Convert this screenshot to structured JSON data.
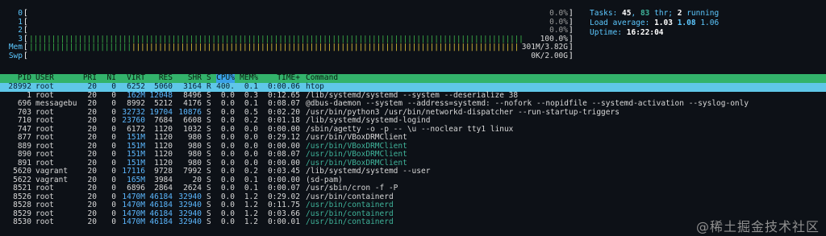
{
  "meters": [
    {
      "label": "0",
      "bar": "",
      "value": "0.0%"
    },
    {
      "label": "1",
      "bar": "",
      "value": "0.0%"
    },
    {
      "label": "2",
      "bar": "",
      "value": "0.0%"
    },
    {
      "label": "3",
      "bar": "|||||||||||||||||||||||||||||||||||||||||||||||||||||||||||||||||||||||||||||||||||||||||||||||||||||||||||||||||||||||||||||||||||||||||||||||||",
      "value": "100.0%"
    },
    {
      "label": "Mem",
      "bar_green": "|||||||||||||||||||||||",
      "bar_yellow": "|||||||||||||||||||||||||||||||||||||||||||||||||||||||||||||||||||||||||||||||||||||||||||||||||||||",
      "value": "301M/3.82G"
    },
    {
      "label": "Swp",
      "bar": "",
      "value": "0K/2.00G"
    }
  ],
  "summary": {
    "tasks_label": "Tasks: ",
    "tasks": "45",
    "tasks_sep": ", ",
    "threads": "83",
    "threads_label": " thr; ",
    "running": "2",
    "running_label": " running",
    "load_label": "Load average: ",
    "load1": "1.03",
    "load5": "1.08",
    "load15": "1.06",
    "uptime_label": "Uptime: ",
    "uptime": "16:22:04"
  },
  "columns": {
    "pid": "PID",
    "user": "USER",
    "pri": "PRI",
    "ni": "NI",
    "virt": "VIRT",
    "res": "RES",
    "shr": "SHR",
    "s": "S",
    "cpu": "CPU%",
    "mem": "MEM%",
    "time": "TIME+",
    "cmd": "Command"
  },
  "processes": [
    {
      "pid": "28992",
      "user": "root",
      "pri": "20",
      "ni": "0",
      "virt": "6252",
      "res": "5060",
      "shr": "3164",
      "s": "R",
      "cpu": "400.",
      "mem": "0.1",
      "time": "0:00.06",
      "cmd": "htop",
      "thread": false
    },
    {
      "pid": "1",
      "user": "root",
      "pri": "20",
      "ni": "0",
      "virt": "162M",
      "res": "12048",
      "shr": "8496",
      "s": "S",
      "cpu": "0.0",
      "mem": "0.3",
      "time": "0:12.65",
      "cmd": "/lib/systemd/systemd --system --deserialize 38",
      "thread": false
    },
    {
      "pid": "696",
      "user": "messagebu",
      "pri": "20",
      "ni": "0",
      "virt": "8992",
      "res": "5212",
      "shr": "4176",
      "s": "S",
      "cpu": "0.0",
      "mem": "0.1",
      "time": "0:08.07",
      "cmd": "@dbus-daemon --system --address=systemd: --nofork --nopidfile --systemd-activation --syslog-only",
      "thread": false
    },
    {
      "pid": "703",
      "user": "root",
      "pri": "20",
      "ni": "0",
      "virt": "32732",
      "res": "19704",
      "shr": "10876",
      "s": "S",
      "cpu": "0.0",
      "mem": "0.5",
      "time": "0:02.20",
      "cmd": "/usr/bin/python3 /usr/bin/networkd-dispatcher --run-startup-triggers",
      "thread": false
    },
    {
      "pid": "710",
      "user": "root",
      "pri": "20",
      "ni": "0",
      "virt": "23760",
      "res": "7684",
      "shr": "6608",
      "s": "S",
      "cpu": "0.0",
      "mem": "0.2",
      "time": "0:01.18",
      "cmd": "/lib/systemd/systemd-logind",
      "thread": false
    },
    {
      "pid": "747",
      "user": "root",
      "pri": "20",
      "ni": "0",
      "virt": "6172",
      "res": "1120",
      "shr": "1032",
      "s": "S",
      "cpu": "0.0",
      "mem": "0.0",
      "time": "0:00.00",
      "cmd": "/sbin/agetty -o -p -- \\u --noclear tty1 linux",
      "thread": false
    },
    {
      "pid": "877",
      "user": "root",
      "pri": "20",
      "ni": "0",
      "virt": "151M",
      "res": "1120",
      "shr": "980",
      "s": "S",
      "cpu": "0.0",
      "mem": "0.0",
      "time": "0:29.12",
      "cmd": "/usr/bin/VBoxDRMClient",
      "thread": false
    },
    {
      "pid": "889",
      "user": "root",
      "pri": "20",
      "ni": "0",
      "virt": "151M",
      "res": "1120",
      "shr": "980",
      "s": "S",
      "cpu": "0.0",
      "mem": "0.0",
      "time": "0:00.00",
      "cmd": "/usr/bin/VBoxDRMClient",
      "thread": true
    },
    {
      "pid": "890",
      "user": "root",
      "pri": "20",
      "ni": "0",
      "virt": "151M",
      "res": "1120",
      "shr": "980",
      "s": "S",
      "cpu": "0.0",
      "mem": "0.0",
      "time": "0:08.07",
      "cmd": "/usr/bin/VBoxDRMClient",
      "thread": true
    },
    {
      "pid": "891",
      "user": "root",
      "pri": "20",
      "ni": "0",
      "virt": "151M",
      "res": "1120",
      "shr": "980",
      "s": "S",
      "cpu": "0.0",
      "mem": "0.0",
      "time": "0:00.00",
      "cmd": "/usr/bin/VBoxDRMClient",
      "thread": true
    },
    {
      "pid": "5620",
      "user": "vagrant",
      "pri": "20",
      "ni": "0",
      "virt": "17116",
      "res": "9728",
      "shr": "7992",
      "s": "S",
      "cpu": "0.0",
      "mem": "0.2",
      "time": "0:03.45",
      "cmd": "/lib/systemd/systemd --user",
      "thread": false
    },
    {
      "pid": "5622",
      "user": "vagrant",
      "pri": "20",
      "ni": "0",
      "virt": "165M",
      "res": "3984",
      "shr": "20",
      "s": "S",
      "cpu": "0.0",
      "mem": "0.1",
      "time": "0:00.00",
      "cmd": "(sd-pam)",
      "thread": false
    },
    {
      "pid": "8521",
      "user": "root",
      "pri": "20",
      "ni": "0",
      "virt": "6896",
      "res": "2864",
      "shr": "2624",
      "s": "S",
      "cpu": "0.0",
      "mem": "0.1",
      "time": "0:00.07",
      "cmd": "/usr/sbin/cron -f -P",
      "thread": false
    },
    {
      "pid": "8526",
      "user": "root",
      "pri": "20",
      "ni": "0",
      "virt": "1470M",
      "res": "46184",
      "shr": "32940",
      "s": "S",
      "cpu": "0.0",
      "mem": "1.2",
      "time": "0:29.02",
      "cmd": "/usr/bin/containerd",
      "thread": false
    },
    {
      "pid": "8528",
      "user": "root",
      "pri": "20",
      "ni": "0",
      "virt": "1470M",
      "res": "46184",
      "shr": "32940",
      "s": "S",
      "cpu": "0.0",
      "mem": "1.2",
      "time": "0:11.75",
      "cmd": "/usr/bin/containerd",
      "thread": true
    },
    {
      "pid": "8529",
      "user": "root",
      "pri": "20",
      "ni": "0",
      "virt": "1470M",
      "res": "46184",
      "shr": "32940",
      "s": "S",
      "cpu": "0.0",
      "mem": "1.2",
      "time": "0:03.66",
      "cmd": "/usr/bin/containerd",
      "thread": true
    },
    {
      "pid": "8530",
      "user": "root",
      "pri": "20",
      "ni": "0",
      "virt": "1470M",
      "res": "46184",
      "shr": "32940",
      "s": "S",
      "cpu": "0.0",
      "mem": "1.2",
      "time": "0:00.01",
      "cmd": "/usr/bin/containerd",
      "thread": true
    }
  ],
  "watermark": "@稀土掘金技术社区",
  "colors": {
    "header_bg": "#33b36b",
    "selected_bg": "#5fc7e8",
    "sort_bg": "#3aa1e8",
    "accent": "#5cc8ff",
    "thread": "#3fb39a"
  }
}
